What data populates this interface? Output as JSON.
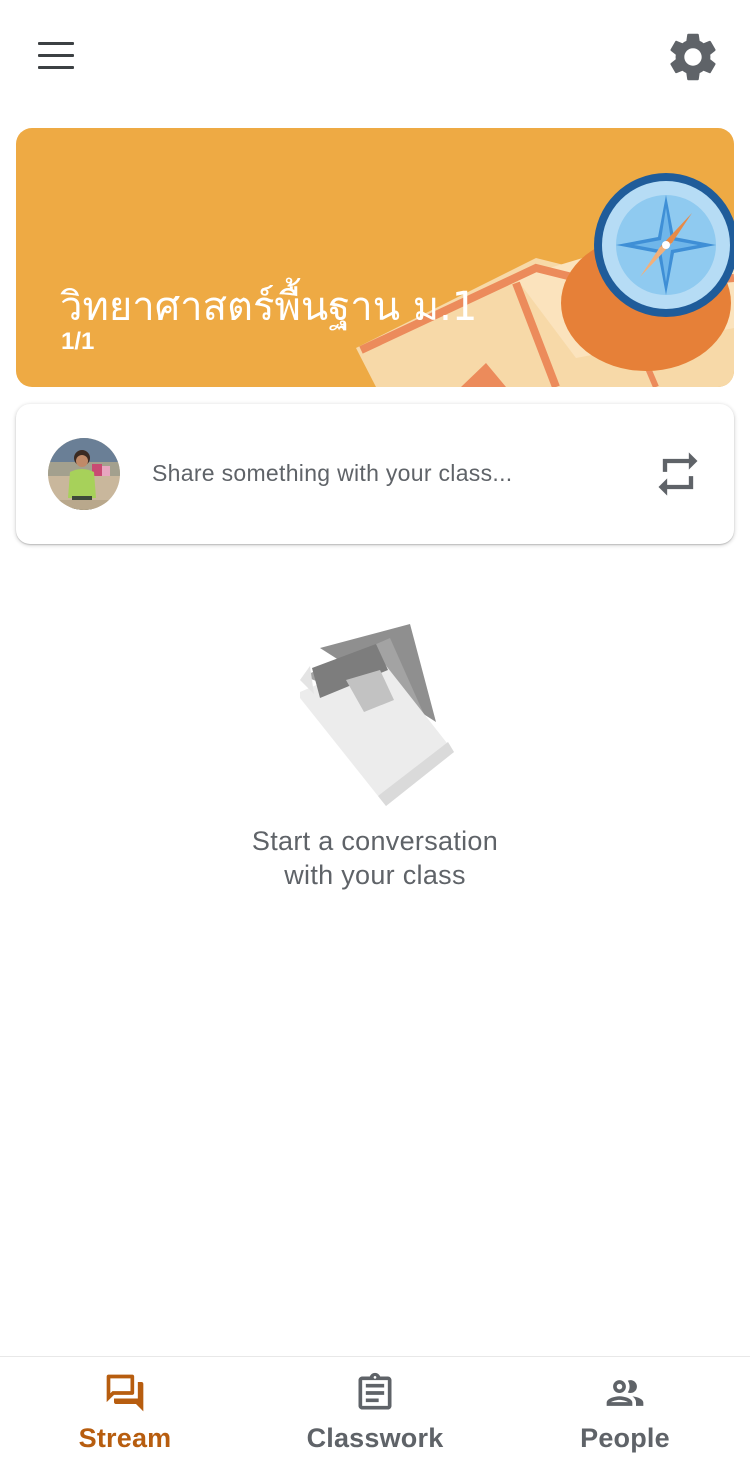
{
  "header": {
    "menu_icon": "hamburger-menu-icon",
    "settings_icon": "gear-icon"
  },
  "banner": {
    "title": "วิทยาศาสตร์พื้นฐาน ม.1",
    "section": "1/1",
    "background_color": "#eeaa44",
    "theme_art": "compass-and-map-illustration"
  },
  "share": {
    "placeholder": "Share something with your class...",
    "repost_icon": "repeat-icon"
  },
  "empty_state": {
    "line1": "Start a conversation",
    "line2": "with your class",
    "illustration": "stacked-documents-icon"
  },
  "bottom_nav": {
    "active_color": "#b75d0f",
    "inactive_color": "#5f6368",
    "items": [
      {
        "label": "Stream",
        "icon": "forum-icon",
        "active": true
      },
      {
        "label": "Classwork",
        "icon": "assignment-icon",
        "active": false
      },
      {
        "label": "People",
        "icon": "people-icon",
        "active": false
      }
    ]
  }
}
